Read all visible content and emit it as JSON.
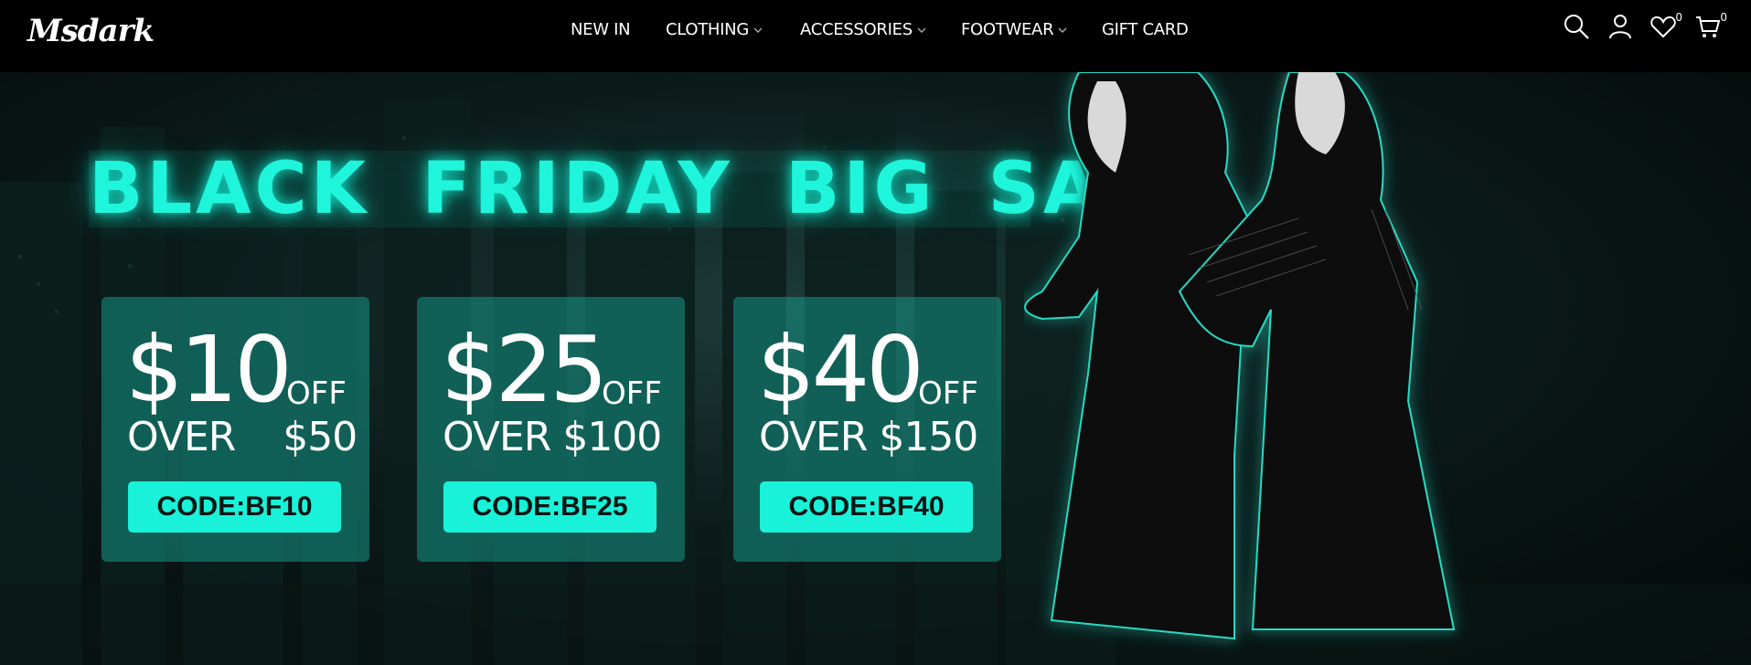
{
  "brand": {
    "logo_text": "Msdark"
  },
  "nav": {
    "items": [
      {
        "label": "NEW IN",
        "has_dropdown": false
      },
      {
        "label": "CLOTHING",
        "has_dropdown": true
      },
      {
        "label": "ACCESSORIES",
        "has_dropdown": true
      },
      {
        "label": "FOOTWEAR",
        "has_dropdown": true
      },
      {
        "label": "GIFT CARD",
        "has_dropdown": false
      }
    ]
  },
  "header_icons": {
    "search": "search-icon",
    "account": "user-icon",
    "wishlist": {
      "icon": "heart-icon",
      "count": "0"
    },
    "cart": {
      "icon": "cart-icon",
      "count": "0"
    }
  },
  "hero": {
    "headline": "BLACK FRIDAY BIG SALE",
    "accent_color": "#1ff5da",
    "coupons": [
      {
        "amount": "$10",
        "off": "OFF",
        "condition": "OVER    $50",
        "code": "CODE:BF10"
      },
      {
        "amount": "$25",
        "off": "OFF",
        "condition": "OVER $100",
        "code": "CODE:BF25"
      },
      {
        "amount": "$40",
        "off": "OFF",
        "condition": "OVER $150",
        "code": "CODE:BF40"
      }
    ]
  }
}
